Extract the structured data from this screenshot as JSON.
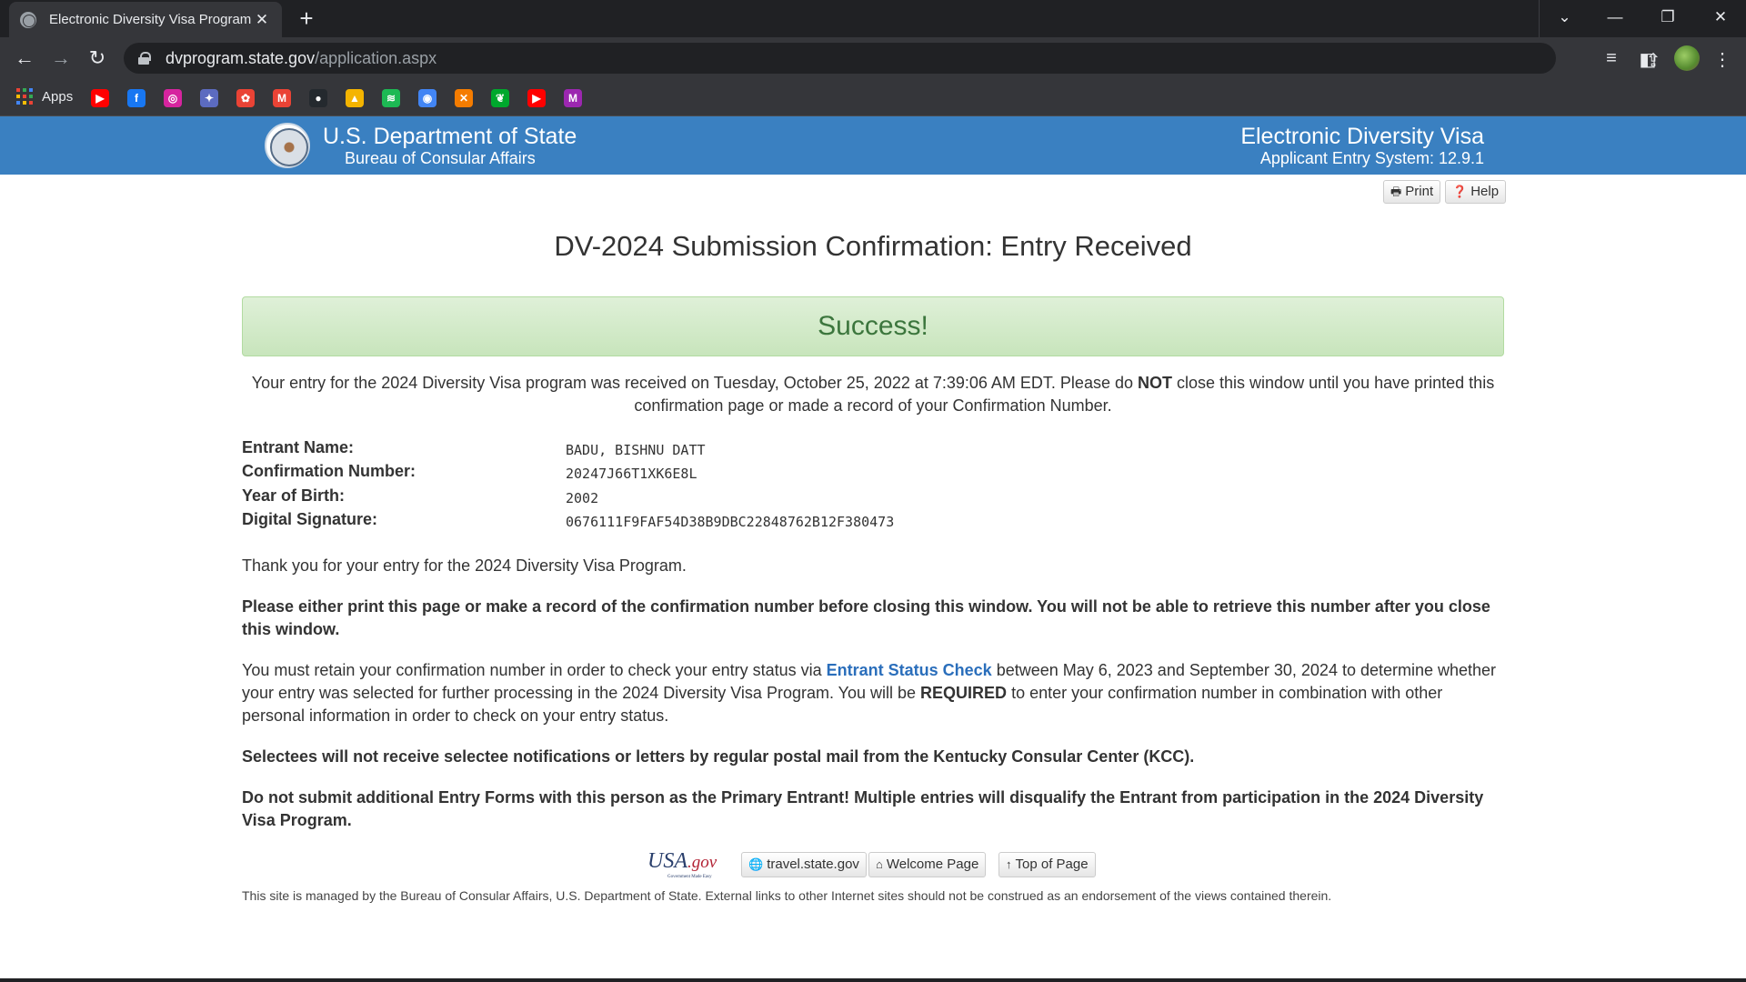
{
  "browser": {
    "tab_title": "Electronic Diversity Visa Program",
    "url_host": "dvprogram.state.gov",
    "url_path": "/application.aspx",
    "apps_label": "Apps",
    "bookmarks": [
      {
        "name": "youtube-icon",
        "color": "#ff0000",
        "glyph": "▶"
      },
      {
        "name": "facebook-icon",
        "color": "#1877f2",
        "glyph": "f"
      },
      {
        "name": "instagram-icon",
        "color": "#d6249f",
        "glyph": "◎"
      },
      {
        "name": "bookmark-app-icon",
        "color": "#5c6bc0",
        "glyph": "✦"
      },
      {
        "name": "google-photos-icon",
        "color": "#ea4335",
        "glyph": "✿"
      },
      {
        "name": "gmail-icon",
        "color": "#ea4335",
        "glyph": "M"
      },
      {
        "name": "github-icon",
        "color": "#24292e",
        "glyph": "●"
      },
      {
        "name": "google-drive-icon",
        "color": "#f4b400",
        "glyph": "▲"
      },
      {
        "name": "spotify-icon",
        "color": "#1db954",
        "glyph": "≋"
      },
      {
        "name": "google-lens-icon",
        "color": "#4285f4",
        "glyph": "◉"
      },
      {
        "name": "xda-icon",
        "color": "#f57c00",
        "glyph": "✕"
      },
      {
        "name": "evernote-icon",
        "color": "#00a82d",
        "glyph": "❦"
      },
      {
        "name": "youtube-icon-2",
        "color": "#ff0000",
        "glyph": "▶"
      },
      {
        "name": "monday-icon",
        "color": "#9c27b0",
        "glyph": "M"
      }
    ]
  },
  "header": {
    "dept": "U.S. Department of State",
    "bureau": "Bureau of Consular Affairs",
    "program": "Electronic Diversity Visa",
    "system": "Applicant Entry System: 12.9.1"
  },
  "actions": {
    "print": "Print",
    "help": "Help"
  },
  "main": {
    "title": "DV-2024 Submission Confirmation: Entry Received",
    "success": "Success!",
    "received_part1": "Your entry for the 2024 Diversity Visa program was received on Tuesday, October 25, 2022 at 7:39:06 AM EDT. Please do ",
    "received_bold": "NOT",
    "received_part2": " close this window until you have printed this confirmation page or made a record of your Confirmation Number.",
    "fields": [
      {
        "label": "Entrant Name:",
        "value": "BADU, BISHNU DATT"
      },
      {
        "label": "Confirmation Number:",
        "value": "20247J66T1XK6E8L"
      },
      {
        "label": "Year of Birth:",
        "value": "2002"
      },
      {
        "label": "Digital Signature:",
        "value": "0676111F9FAF54D38B9DBC22848762B12F380473"
      }
    ],
    "thank_you": "Thank you for your entry for the 2024 Diversity Visa Program.",
    "print_warning": "Please either print this page or make a record of the confirmation number before closing this window. You will not be able to retrieve this number after you close this window.",
    "retain_part1": "You must retain your confirmation number in order to check your entry status via ",
    "retain_link": "Entrant Status Check",
    "retain_part2": " between May 6, 2023 and September 30, 2024 to determine whether your entry was selected for further processing in the 2024 Diversity Visa Program. You will be ",
    "retain_bold": "REQUIRED",
    "retain_part3": " to enter your confirmation number in combination with other personal information in order to check on your entry status.",
    "selectees_notice": "Selectees will not receive selectee notifications or letters by regular postal mail from the Kentucky Consular Center (KCC).",
    "duplicate_warning": "Do not submit additional Entry Forms with this person as the Primary Entrant! Multiple entries will disqualify the Entrant from participation in the 2024 Diversity Visa Program."
  },
  "footer": {
    "logo_usa": "USA",
    "logo_gov": ".gov",
    "logo_tagline": "Government Made Easy",
    "travel": "travel.state.gov",
    "welcome": "Welcome Page",
    "top": "Top of Page",
    "disclaimer": "This site is managed by the Bureau of Consular Affairs, U.S. Department of State. External links to other Internet sites should not be construed as an endorsement of the views contained therein."
  }
}
